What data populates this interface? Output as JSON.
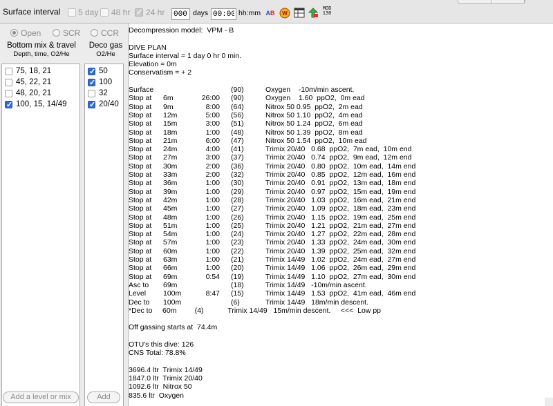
{
  "toolbar": {
    "title": "Surface interval",
    "options": [
      {
        "label": "5 day",
        "checked": false
      },
      {
        "label": "48 hr",
        "checked": false
      },
      {
        "label": "24 hr",
        "checked": true
      }
    ],
    "days_value": "000",
    "days_label": "days",
    "hhmm_value": "00:00",
    "hhmm_label": "hh:mm",
    "icons": [
      "spell-check-icon",
      "dive-warning-icon",
      "table-icon",
      "export-icon",
      "mod-icon"
    ],
    "mod_icon_text": "MOD 130"
  },
  "mode": {
    "open": "Open",
    "scr": "SCR",
    "ccr": "CCR",
    "selected": "Open"
  },
  "bottom_mix": {
    "title": "Bottom mix & travel",
    "subtitle": "Depth, time, O2/He",
    "items": [
      {
        "label": "75, 18, 21",
        "checked": false
      },
      {
        "label": "45, 22, 21",
        "checked": false
      },
      {
        "label": "48, 20, 21",
        "checked": false
      },
      {
        "label": "100, 15, 14/49",
        "checked": true
      }
    ],
    "add_button": "Add a level or mix"
  },
  "deco_gas": {
    "title": "Deco gas",
    "subtitle": "O2/He",
    "items": [
      {
        "label": "50",
        "checked": true
      },
      {
        "label": "100",
        "checked": true
      },
      {
        "label": "32",
        "checked": false
      },
      {
        "label": "20/40",
        "checked": true
      }
    ],
    "add_button": "Add"
  },
  "output": {
    "model": "Decompression model:  VPM - B",
    "header": [
      "DIVE PLAN",
      "Surface interval = 1 day 0 hr 0 min.",
      "Elevation = 0m",
      "Conservatism = + 2"
    ],
    "plan": [
      [
        "Surface",
        "",
        "",
        "(90)",
        "Oxygen    -10m/min ascent."
      ],
      [
        "Stop at",
        "6m",
        "26:00",
        "(90)",
        "Oxygen    1.60  ppO2,  0m ead"
      ],
      [
        "Stop at",
        "9m",
        "8:00",
        "(64)",
        "Nitrox 50 0.95  ppO2,  2m ead"
      ],
      [
        "Stop at",
        "12m",
        "5:00",
        "(56)",
        "Nitrox 50 1.10  ppO2,  4m ead"
      ],
      [
        "Stop at",
        "15m",
        "3:00",
        "(51)",
        "Nitrox 50 1.24  ppO2,  6m ead"
      ],
      [
        "Stop at",
        "18m",
        "1:00",
        "(48)",
        "Nitrox 50 1.39  ppO2,  8m ead"
      ],
      [
        "Stop at",
        "21m",
        "6:00",
        "(47)",
        "Nitrox 50 1.54  ppO2,  10m ead"
      ],
      [
        "Stop at",
        "24m",
        "4:00",
        "(41)",
        "Trimix 20/40   0.68  ppO2,  7m ead,  10m end"
      ],
      [
        "Stop at",
        "27m",
        "3:00",
        "(37)",
        "Trimix 20/40   0.74  ppO2,  9m ead,  12m end"
      ],
      [
        "Stop at",
        "30m",
        "2:00",
        "(36)",
        "Trimix 20/40   0.80  ppO2,  10m ead,  14m end"
      ],
      [
        "Stop at",
        "33m",
        "2:00",
        "(32)",
        "Trimix 20/40   0.85  ppO2,  12m ead,  16m end"
      ],
      [
        "Stop at",
        "36m",
        "1:00",
        "(30)",
        "Trimix 20/40   0.91  ppO2,  13m ead,  18m end"
      ],
      [
        "Stop at",
        "39m",
        "1:00",
        "(29)",
        "Trimix 20/40   0.97  ppO2,  15m ead,  19m end"
      ],
      [
        "Stop at",
        "42m",
        "1:00",
        "(28)",
        "Trimix 20/40   1.03  ppO2,  16m ead,  21m end"
      ],
      [
        "Stop at",
        "45m",
        "1:00",
        "(27)",
        "Trimix 20/40   1.09  ppO2,  18m ead,  23m end"
      ],
      [
        "Stop at",
        "48m",
        "1:00",
        "(26)",
        "Trimix 20/40   1.15  ppO2,  19m ead,  25m end"
      ],
      [
        "Stop at",
        "51m",
        "1:00",
        "(25)",
        "Trimix 20/40   1.21  ppO2,  21m ead,  27m end"
      ],
      [
        "Stop at",
        "54m",
        "1:00",
        "(24)",
        "Trimix 20/40   1.27  ppO2,  22m ead,  28m end"
      ],
      [
        "Stop at",
        "57m",
        "1:00",
        "(23)",
        "Trimix 20/40   1.33  ppO2,  24m ead,  30m end"
      ],
      [
        "Stop at",
        "60m",
        "1:00",
        "(22)",
        "Trimix 20/40   1.39  ppO2,  25m ead,  32m end"
      ],
      [
        "Stop at",
        "63m",
        "1:00",
        "(21)",
        "Trimix 14/49   1.02  ppO2,  24m ead,  27m end"
      ],
      [
        "Stop at",
        "66m",
        "1:00",
        "(20)",
        "Trimix 14/49   1.06  ppO2,  26m ead,  29m end"
      ],
      [
        "Stop at",
        "69m",
        "0:54",
        "(19)",
        "Trimix 14/49   1.10  ppO2,  27m ead,  30m end"
      ],
      [
        "Asc to",
        "69m",
        "",
        "(18)",
        "Trimix 14/49   -10m/min ascent."
      ],
      [
        "Level",
        "100m",
        "8:47",
        "(15)",
        "Trimix 14/49   1.53  ppO2,  41m ead,  46m end"
      ],
      [
        "Dec to",
        "100m",
        "",
        "(6)",
        "Trimix 14/49   18m/min descent."
      ]
    ],
    "dec_line": "*Dec to     60m         (4)            Trimix 14/49   15m/min descent.     <<<  Low pp",
    "offgassing": "Off gassing starts at  74.4m",
    "otu": "OTU's this dive: 126",
    "cns": "CNS Total: 78.8%",
    "gas_totals": [
      "3696.4 ltr  Trimix 14/49",
      "1847.0 ltr  Trimix 20/40",
      "1092.6 ltr  Nitrox 50",
      "835.6 ltr  Oxygen"
    ]
  }
}
